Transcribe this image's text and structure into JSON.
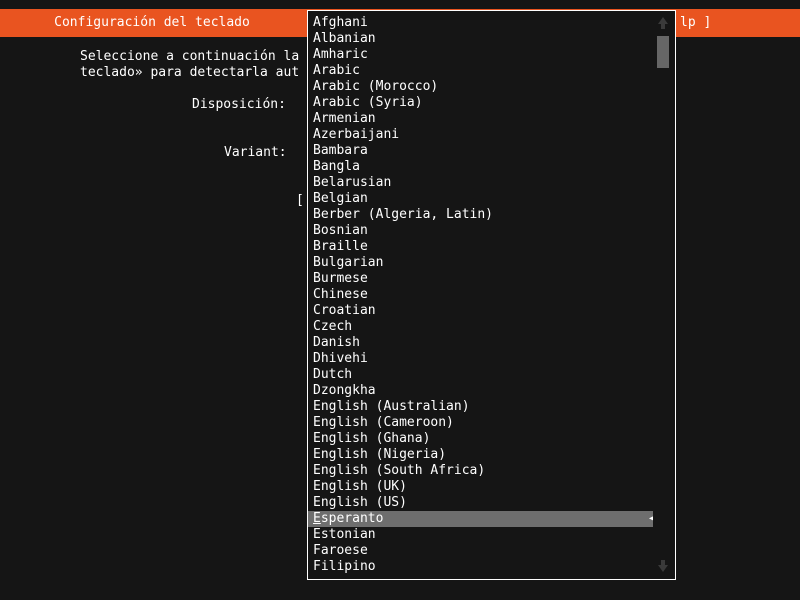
{
  "header": {
    "title": "Configuración del teclado",
    "right_fragment": "lp ]",
    "accent_color": "#e95420",
    "background_color": "#151515",
    "text_color": "#ffffff"
  },
  "form": {
    "intro_line_1": "Seleccione a continuación la",
    "intro_line_2": "teclado» para detectarla aut",
    "layout_label": "Disposición:",
    "variant_label": "Variant:",
    "bracket_stub": "["
  },
  "dropdown": {
    "selected_value": "English (US)",
    "selected_index": 31,
    "selection_marker": "◀",
    "highlight_color": "#6e6e6e",
    "border_color": "#ffffff",
    "items": [
      "Afghani",
      "Albanian",
      "Amharic",
      "Arabic",
      "Arabic (Morocco)",
      "Arabic (Syria)",
      "Armenian",
      "Azerbaijani",
      "Bambara",
      "Bangla",
      "Belarusian",
      "Belgian",
      "Berber (Algeria, Latin)",
      "Bosnian",
      "Braille",
      "Bulgarian",
      "Burmese",
      "Chinese",
      "Croatian",
      "Czech",
      "Danish",
      "Dhivehi",
      "Dutch",
      "Dzongkha",
      "English (Australian)",
      "English (Cameroon)",
      "English (Ghana)",
      "English (Nigeria)",
      "English (South Africa)",
      "English (UK)",
      "English (US)",
      "Esperanto",
      "Estonian",
      "Faroese",
      "Filipino"
    ],
    "scrollbar": {
      "up_arrow": "scroll-up-arrow",
      "down_arrow": "scroll-down-arrow",
      "thumb_color": "#666666",
      "arrow_color": "#3a3a3a"
    }
  }
}
